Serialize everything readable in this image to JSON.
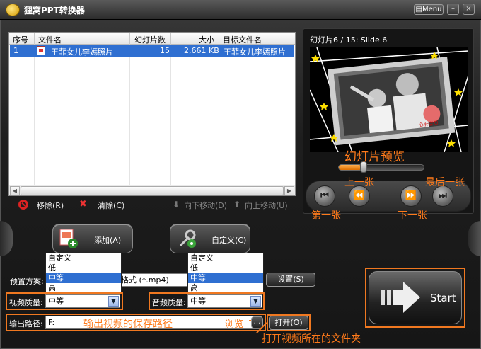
{
  "app": {
    "title": "狸窝PPT转换器",
    "menu_label": "Menu",
    "minimize_glyph": "–",
    "close_glyph": "×"
  },
  "file_list": {
    "columns": [
      "序号",
      "文件名",
      "幻灯片数",
      "大小",
      "目标文件名"
    ],
    "rows": [
      {
        "index": "1",
        "name": "王菲女儿李嫣照片",
        "slides": "15",
        "size": "2,661 KB",
        "target": "王菲女儿李嫣照片"
      }
    ],
    "scroll_left_glyph": "◀",
    "scroll_right_glyph": "▶"
  },
  "list_actions": {
    "remove": "移除(R)",
    "clear": "清除(C)",
    "move_down": "向下移动(D)",
    "move_up": "向上移动(U)"
  },
  "preview": {
    "caption": "幻灯片6 / 15: Slide 6",
    "progress_fraction": 0.27,
    "photo_text": "心肝宝贝"
  },
  "buttons": {
    "add": "添加(A)",
    "custom": "自定义(C)",
    "settings": "设置(S)",
    "open": "打开(O)",
    "start": "Start",
    "browse_glyph": "…"
  },
  "form": {
    "preset_label": "预置方案:",
    "preset_value": "格式 (*.mp4)",
    "video_quality_label": "视频质量:",
    "video_quality_value": "中等",
    "audio_quality_label": "音频质量:",
    "audio_quality_value": "中等",
    "output_label": "输出路径:",
    "output_value": "F:",
    "browse_label": "浏览"
  },
  "quality_options": [
    "自定义",
    "低",
    "中等",
    "高"
  ],
  "quality_selected_index": 2,
  "annotations": {
    "preview": "幻灯片预览",
    "prev": "上一张",
    "last": "最后一张",
    "first": "第一张",
    "next": "下一张",
    "output_path": "输出视频的保存路径",
    "browse": "浏览",
    "open_folder": "打开视频所在的文件夹"
  },
  "colors": {
    "accent_orange": "#f07820",
    "selection_blue": "#2f6fd1"
  },
  "icons": [
    "app-logo-icon",
    "remove-icon",
    "clear-icon",
    "move-down-icon",
    "move-up-icon",
    "add-files-icon",
    "custom-tools-icon",
    "start-arrow-icon",
    "first-icon",
    "prev-icon",
    "next-icon",
    "last-icon",
    "folder-icon"
  ]
}
